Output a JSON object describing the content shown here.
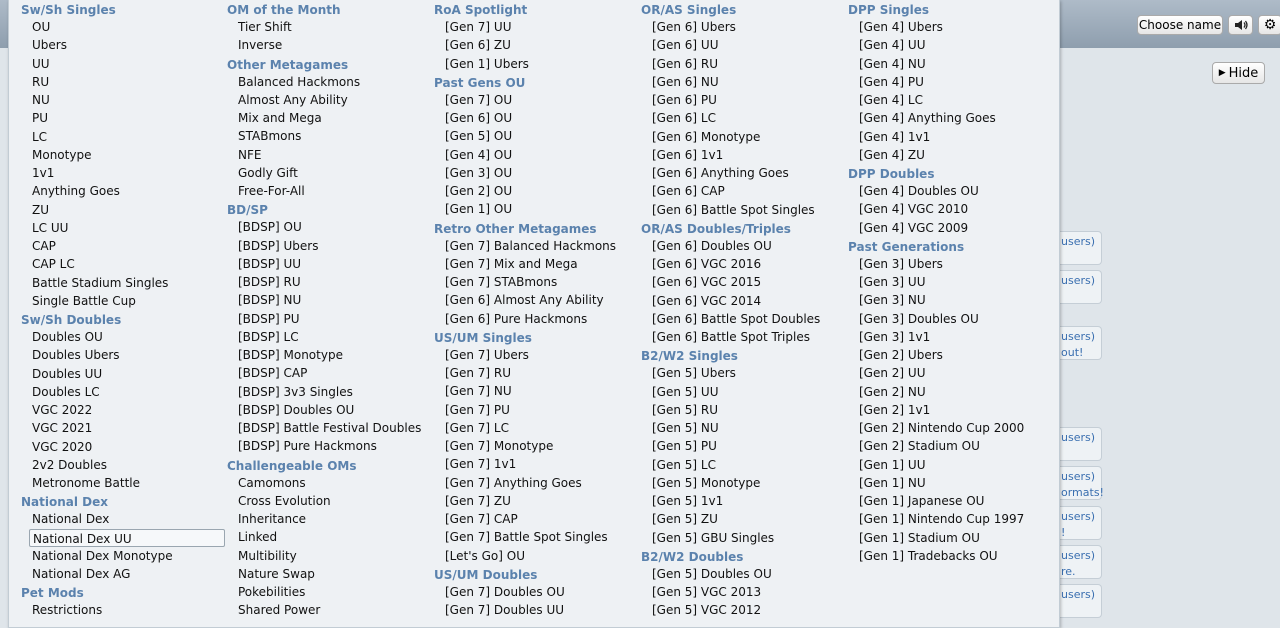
{
  "topbar": {
    "choose_name_label": "Choose name"
  },
  "main": {
    "hide_label": "Hide",
    "side_fragments": [
      "users)",
      "users)",
      "users)\nout!",
      "users)",
      "users)\normats!",
      "users)\n!",
      "users)\nre.",
      "users)"
    ]
  },
  "format_menu": {
    "columns": [
      {
        "sections": [
          {
            "header": "Sw/Sh Singles",
            "items": [
              "OU",
              "Ubers",
              "UU",
              "RU",
              "NU",
              "PU",
              "LC",
              "Monotype",
              "1v1",
              "Anything Goes",
              "ZU",
              "LC UU",
              "CAP",
              "CAP LC",
              "Battle Stadium Singles",
              "Single Battle Cup"
            ]
          },
          {
            "header": "Sw/Sh Doubles",
            "items": [
              "Doubles OU",
              "Doubles Ubers",
              "Doubles UU",
              "Doubles LC",
              "VGC 2022",
              "VGC 2021",
              "VGC 2020",
              "2v2 Doubles",
              "Metronome Battle"
            ]
          },
          {
            "header": "National Dex",
            "items": [
              "National Dex",
              "National Dex UU",
              "National Dex Monotype",
              "National Dex AG"
            ]
          },
          {
            "header": "Pet Mods",
            "items": [
              "Restrictions"
            ]
          }
        ]
      },
      {
        "sections": [
          {
            "header": "OM of the Month",
            "items": [
              "Tier Shift",
              "Inverse"
            ]
          },
          {
            "header": "Other Metagames",
            "items": [
              "Balanced Hackmons",
              "Almost Any Ability",
              "Mix and Mega",
              "STABmons",
              "NFE",
              "Godly Gift",
              "Free-For-All"
            ]
          },
          {
            "header": "BD/SP",
            "items": [
              "[BDSP] OU",
              "[BDSP] Ubers",
              "[BDSP] UU",
              "[BDSP] RU",
              "[BDSP] NU",
              "[BDSP] PU",
              "[BDSP] LC",
              "[BDSP] Monotype",
              "[BDSP] CAP",
              "[BDSP] 3v3 Singles",
              "[BDSP] Doubles OU",
              "[BDSP] Battle Festival Doubles",
              "[BDSP] Pure Hackmons"
            ]
          },
          {
            "header": "Challengeable OMs",
            "items": [
              "Camomons",
              "Cross Evolution",
              "Inheritance",
              "Linked",
              "Multibility",
              "Nature Swap",
              "Pokebilities",
              "Shared Power"
            ]
          }
        ]
      },
      {
        "sections": [
          {
            "header": "RoA Spotlight",
            "items": [
              "[Gen 7] UU",
              "[Gen 6] ZU",
              "[Gen 1] Ubers"
            ]
          },
          {
            "header": "Past Gens OU",
            "items": [
              "[Gen 7] OU",
              "[Gen 6] OU",
              "[Gen 5] OU",
              "[Gen 4] OU",
              "[Gen 3] OU",
              "[Gen 2] OU",
              "[Gen 1] OU"
            ]
          },
          {
            "header": "Retro Other Metagames",
            "items": [
              "[Gen 7] Balanced Hackmons",
              "[Gen 7] Mix and Mega",
              "[Gen 7] STABmons",
              "[Gen 6] Almost Any Ability",
              "[Gen 6] Pure Hackmons"
            ]
          },
          {
            "header": "US/UM Singles",
            "items": [
              "[Gen 7] Ubers",
              "[Gen 7] RU",
              "[Gen 7] NU",
              "[Gen 7] PU",
              "[Gen 7] LC",
              "[Gen 7] Monotype",
              "[Gen 7] 1v1",
              "[Gen 7] Anything Goes",
              "[Gen 7] ZU",
              "[Gen 7] CAP",
              "[Gen 7] Battle Spot Singles",
              "[Let's Go] OU"
            ]
          },
          {
            "header": "US/UM Doubles",
            "items": [
              "[Gen 7] Doubles OU",
              "[Gen 7] Doubles UU"
            ]
          }
        ]
      },
      {
        "sections": [
          {
            "header": "OR/AS Singles",
            "items": [
              "[Gen 6] Ubers",
              "[Gen 6] UU",
              "[Gen 6] RU",
              "[Gen 6] NU",
              "[Gen 6] PU",
              "[Gen 6] LC",
              "[Gen 6] Monotype",
              "[Gen 6] 1v1",
              "[Gen 6] Anything Goes",
              "[Gen 6] CAP",
              "[Gen 6] Battle Spot Singles"
            ]
          },
          {
            "header": "OR/AS Doubles/Triples",
            "items": [
              "[Gen 6] Doubles OU",
              "[Gen 6] VGC 2016",
              "[Gen 6] VGC 2015",
              "[Gen 6] VGC 2014",
              "[Gen 6] Battle Spot Doubles",
              "[Gen 6] Battle Spot Triples"
            ]
          },
          {
            "header": "B2/W2 Singles",
            "items": [
              "[Gen 5] Ubers",
              "[Gen 5] UU",
              "[Gen 5] RU",
              "[Gen 5] NU",
              "[Gen 5] PU",
              "[Gen 5] LC",
              "[Gen 5] Monotype",
              "[Gen 5] 1v1",
              "[Gen 5] ZU",
              "[Gen 5] GBU Singles"
            ]
          },
          {
            "header": "B2/W2 Doubles",
            "items": [
              "[Gen 5] Doubles OU",
              "[Gen 5] VGC 2013",
              "[Gen 5] VGC 2012"
            ]
          }
        ]
      },
      {
        "sections": [
          {
            "header": "DPP Singles",
            "items": [
              "[Gen 4] Ubers",
              "[Gen 4] UU",
              "[Gen 4] NU",
              "[Gen 4] PU",
              "[Gen 4] LC",
              "[Gen 4] Anything Goes",
              "[Gen 4] 1v1",
              "[Gen 4] ZU"
            ]
          },
          {
            "header": "DPP Doubles",
            "items": [
              "[Gen 4] Doubles OU",
              "[Gen 4] VGC 2010",
              "[Gen 4] VGC 2009"
            ]
          },
          {
            "header": "Past Generations",
            "items": [
              "[Gen 3] Ubers",
              "[Gen 3] UU",
              "[Gen 3] NU",
              "[Gen 3] Doubles OU",
              "[Gen 3] 1v1",
              "[Gen 2] Ubers",
              "[Gen 2] UU",
              "[Gen 2] NU",
              "[Gen 2] 1v1",
              "[Gen 2] Nintendo Cup 2000",
              "[Gen 2] Stadium OU",
              "[Gen 1] UU",
              "[Gen 1] NU",
              "[Gen 1] Japanese OU",
              "[Gen 1] Nintendo Cup 1997",
              "[Gen 1] Stadium OU",
              "[Gen 1] Tradebacks OU"
            ]
          }
        ]
      }
    ],
    "selected": "National Dex UU"
  }
}
